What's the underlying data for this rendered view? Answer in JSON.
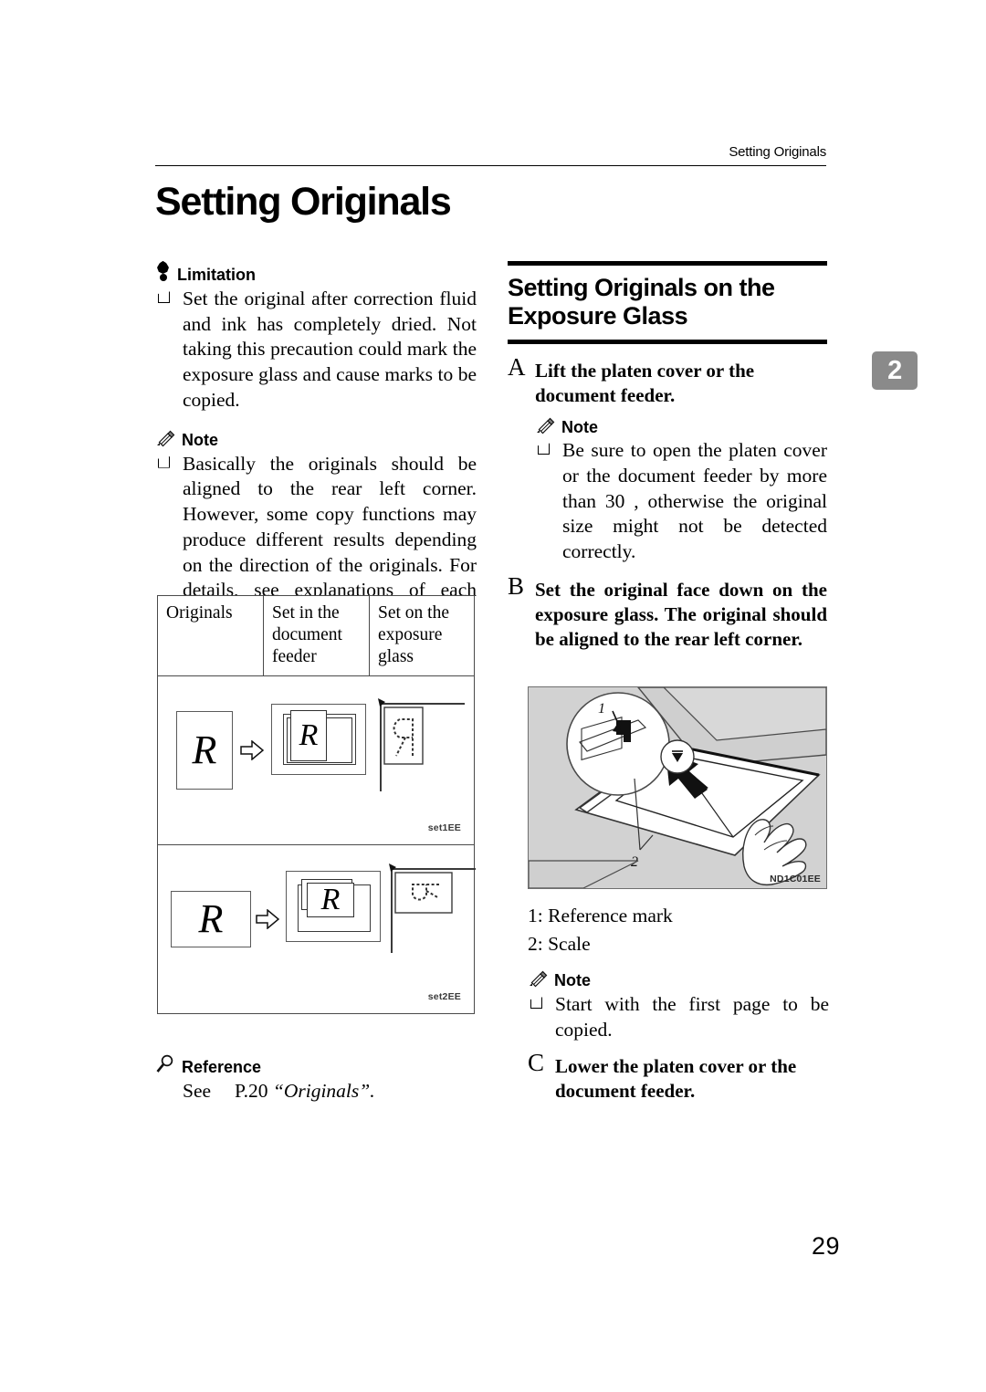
{
  "header": {
    "running_head": "Setting Originals",
    "page_title": "Setting Originals",
    "chapter_tab": "2",
    "page_number": "29"
  },
  "left_column": {
    "limitation": {
      "icon": "limitation-balloon-icon",
      "label": "Limitation",
      "items": [
        "Set the original after correction fluid and ink has completely dried. Not taking this precaution could mark the exposure glass and cause marks to be copied."
      ]
    },
    "note": {
      "icon": "note-pencil-icon",
      "label": "Note",
      "items": [
        "Basically the originals should be aligned to the rear left corner. However, some copy functions may produce different results depending on the direction of the originals. For details, see explanations of each function."
      ]
    },
    "table": {
      "columns": [
        "Originals",
        "Set in the document feeder",
        "Set on the exposure glass"
      ],
      "rows": [
        {
          "figure_code": "set1EE",
          "orientation": "portrait",
          "letter": "R"
        },
        {
          "figure_code": "set2EE",
          "orientation": "landscape",
          "letter": "R"
        }
      ]
    },
    "reference": {
      "icon": "magnifier-reference-icon",
      "label": "Reference",
      "see_word": "See",
      "page_ref": "P.20",
      "target_title": "“Originals”."
    }
  },
  "right_column": {
    "section_title": "Setting Originals on the Exposure Glass",
    "steps": [
      {
        "letter": "A",
        "text": "Lift the platen cover or the document feeder.",
        "note": {
          "icon": "note-pencil-icon",
          "label": "Note",
          "items": [
            "Be sure to open the platen cover or the document feeder by more than 30 , otherwise the original size might not be detected correctly."
          ]
        }
      },
      {
        "letter": "B",
        "text": "Set the original face down on the exposure glass. The original should be aligned to the rear left corner."
      },
      {
        "letter": "C",
        "text": "Lower the platen cover or the document feeder."
      }
    ],
    "illustration": {
      "figure_code": "ND1C01EE",
      "callouts": [
        "1",
        "2"
      ]
    },
    "legend": [
      "1: Reference mark",
      "2: Scale"
    ],
    "note_after_legend": {
      "icon": "note-pencil-icon",
      "label": "Note",
      "items": [
        "Start with the first page to be copied."
      ]
    }
  },
  "colors": {
    "ink": "#000000",
    "tab_gray": "#8a8a8a",
    "illustration_bg": "#d2d2d2",
    "rule_gray": "#4a4a4a"
  }
}
